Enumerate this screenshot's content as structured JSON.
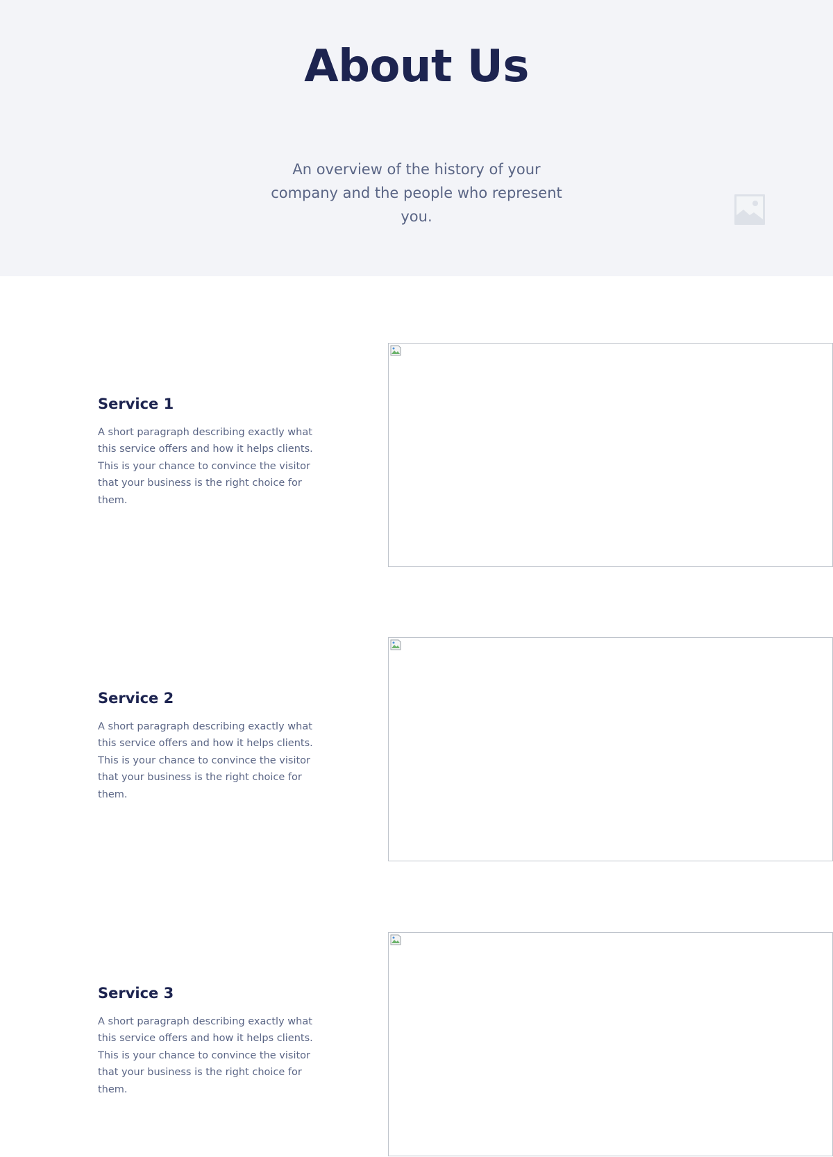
{
  "hero": {
    "title": "About Us",
    "subtitle": "An overview of the history of your company and the people who represent you.",
    "image_icon": "image-placeholder-icon"
  },
  "services": [
    {
      "title": "Service 1",
      "description": "A short paragraph describing exactly what this service offers and how it helps clients. This is your chance to convince the visitor that your business is the right choice for them.",
      "image_icon": "broken-image-icon"
    },
    {
      "title": "Service 2",
      "description": "A short paragraph describing exactly what this service offers and how it helps clients. This is your chance to convince the visitor that your business is the right choice for them.",
      "image_icon": "broken-image-icon"
    },
    {
      "title": "Service 3",
      "description": "A short paragraph describing exactly what this service offers and how it helps clients. This is your chance to convince the visitor that your business is the right choice for them.",
      "image_icon": "broken-image-icon"
    }
  ],
  "colors": {
    "heading": "#1d2450",
    "body_text": "#5a6585",
    "hero_background": "#f3f4f8",
    "image_border": "#bfc4cc"
  }
}
